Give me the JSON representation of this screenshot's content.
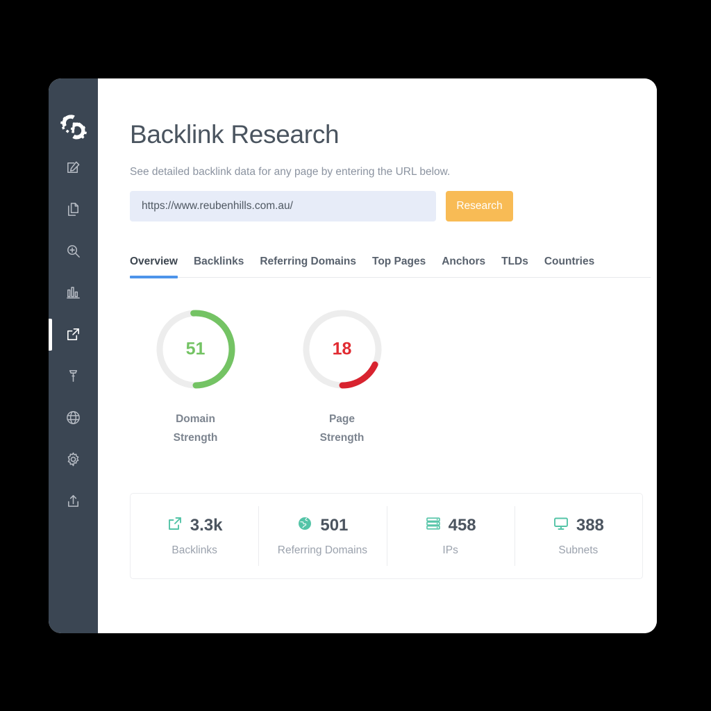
{
  "app": {
    "logo_icon": "gears-logo-icon",
    "sidebar": {
      "items": [
        {
          "icon": "edit-square-icon",
          "name": "edit",
          "active": false
        },
        {
          "icon": "copy-documents-icon",
          "name": "documents",
          "active": false
        },
        {
          "icon": "magnifier-plus-icon",
          "name": "search",
          "active": false
        },
        {
          "icon": "bar-chart-icon",
          "name": "reports",
          "active": false
        },
        {
          "icon": "external-link-icon",
          "name": "backlinks",
          "active": true
        },
        {
          "icon": "hammer-tool-icon",
          "name": "tools",
          "active": false
        },
        {
          "icon": "globe-icon",
          "name": "global",
          "active": false
        },
        {
          "icon": "gear-settings-icon",
          "name": "settings",
          "active": false
        },
        {
          "icon": "upload-icon",
          "name": "upload",
          "active": false
        }
      ]
    }
  },
  "header": {
    "title": "Backlink Research",
    "subtitle": "See detailed backlink data for any page by entering the URL below."
  },
  "search": {
    "value": "https://www.reubenhills.com.au/",
    "placeholder": "https://www.reubenhills.com.au/",
    "button_label": "Research"
  },
  "tabs": [
    {
      "label": "Overview",
      "active": true
    },
    {
      "label": "Backlinks",
      "active": false
    },
    {
      "label": "Referring Domains",
      "active": false
    },
    {
      "label": "Top Pages",
      "active": false
    },
    {
      "label": "Anchors",
      "active": false
    },
    {
      "label": "TLDs",
      "active": false
    },
    {
      "label": "Countries",
      "active": false
    }
  ],
  "gauges": [
    {
      "value": "51",
      "percent": 51,
      "label_line1": "Domain",
      "label_line2": "Strength",
      "color": "#74c364",
      "track_color": "#ededed"
    },
    {
      "value": "18",
      "percent": 18,
      "label_line1": "Page",
      "label_line2": "Strength",
      "color": "#d8232f",
      "track_color": "#ededed"
    }
  ],
  "stats": [
    {
      "icon": "external-link-icon",
      "number": "3.3k",
      "label": "Backlinks"
    },
    {
      "icon": "globe-icon",
      "number": "501",
      "label": "Referring Domains"
    },
    {
      "icon": "server-icon",
      "number": "458",
      "label": "IPs"
    },
    {
      "icon": "monitor-icon",
      "number": "388",
      "label": "Subnets"
    }
  ],
  "chart_data": {
    "type": "pie",
    "title": "Strength gauges",
    "series": [
      {
        "name": "Domain Strength",
        "value": 51,
        "max": 100,
        "color": "#74c364"
      },
      {
        "name": "Page Strength",
        "value": 18,
        "max": 100,
        "color": "#d8232f"
      }
    ]
  },
  "colors": {
    "sidebar_bg": "#3b4653",
    "accent_blue": "#4d94ea",
    "accent_amber": "#f8bb55",
    "accent_teal": "#54c4a7",
    "input_bg": "#e7ecf8"
  }
}
